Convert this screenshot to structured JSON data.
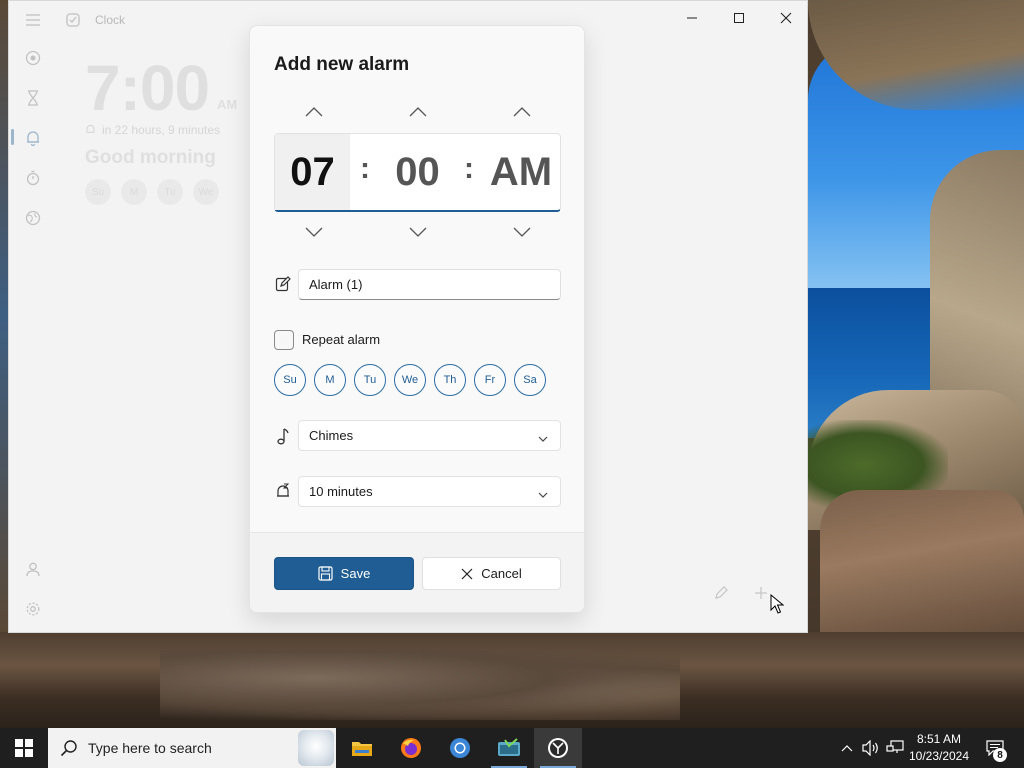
{
  "window": {
    "title": "Clock",
    "background_alarm": {
      "time": "7:00",
      "ampm": "AM",
      "countdown": "in 22 hours, 9 minutes",
      "name": "Good morning",
      "days": [
        "Su",
        "M",
        "Tu",
        "We"
      ]
    }
  },
  "dialog": {
    "title": "Add new alarm",
    "hour": "07",
    "minute": "00",
    "ampm": "AM",
    "separator": ":",
    "alarm_name": "Alarm (1)",
    "repeat_label": "Repeat alarm",
    "repeat_checked": false,
    "days": [
      "Su",
      "M",
      "Tu",
      "We",
      "Th",
      "Fr",
      "Sa"
    ],
    "sound": "Chimes",
    "snooze": "10 minutes",
    "save_label": "Save",
    "cancel_label": "Cancel"
  },
  "taskbar": {
    "search_placeholder": "Type here to search",
    "time": "8:51 AM",
    "date": "10/23/2024",
    "notification_count": "8"
  },
  "colors": {
    "accent": "#1f5d94",
    "taskbar": "#1f1f1f",
    "window": "#f3f3f3"
  }
}
